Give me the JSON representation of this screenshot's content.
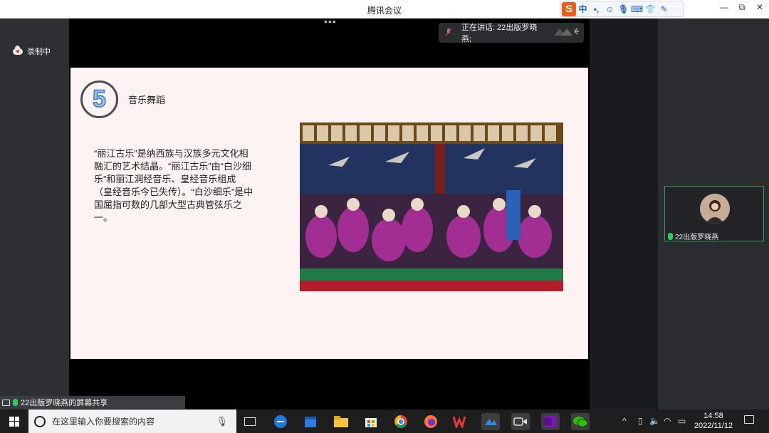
{
  "window": {
    "title": "腾讯会议"
  },
  "ime": {
    "logo": "S",
    "lang": "中",
    "glyphs": [
      "•,",
      "☺",
      "🎙",
      "⌨",
      "👕",
      "✎"
    ]
  },
  "window_controls": {
    "minimize": "—",
    "restore": "⧉",
    "close": "✕"
  },
  "left_panel": {
    "recording_label": "录制中"
  },
  "stage": {
    "dots": "•••",
    "speaking_label": "正在讲话: 22出版罗晓燕;"
  },
  "slide": {
    "number": "5",
    "title": "音乐舞蹈",
    "body": "“丽江古乐”是纳西族与汉族多元文化相融汇的艺术结晶。“丽江古乐”由“白沙细乐”和丽江洞经音乐、皇经音乐组成（皇经音乐今已失传）。“白沙细乐”是中国屈指可数的几部大型古典管弦乐之一。"
  },
  "participant": {
    "name": "22出版罗晓燕"
  },
  "share_bar": {
    "text": "22出版罗晓燕的屏幕共享"
  },
  "taskbar": {
    "search_placeholder": "在这里输入你要搜索的内容",
    "time": "14:58",
    "date": "2022/11/12"
  }
}
